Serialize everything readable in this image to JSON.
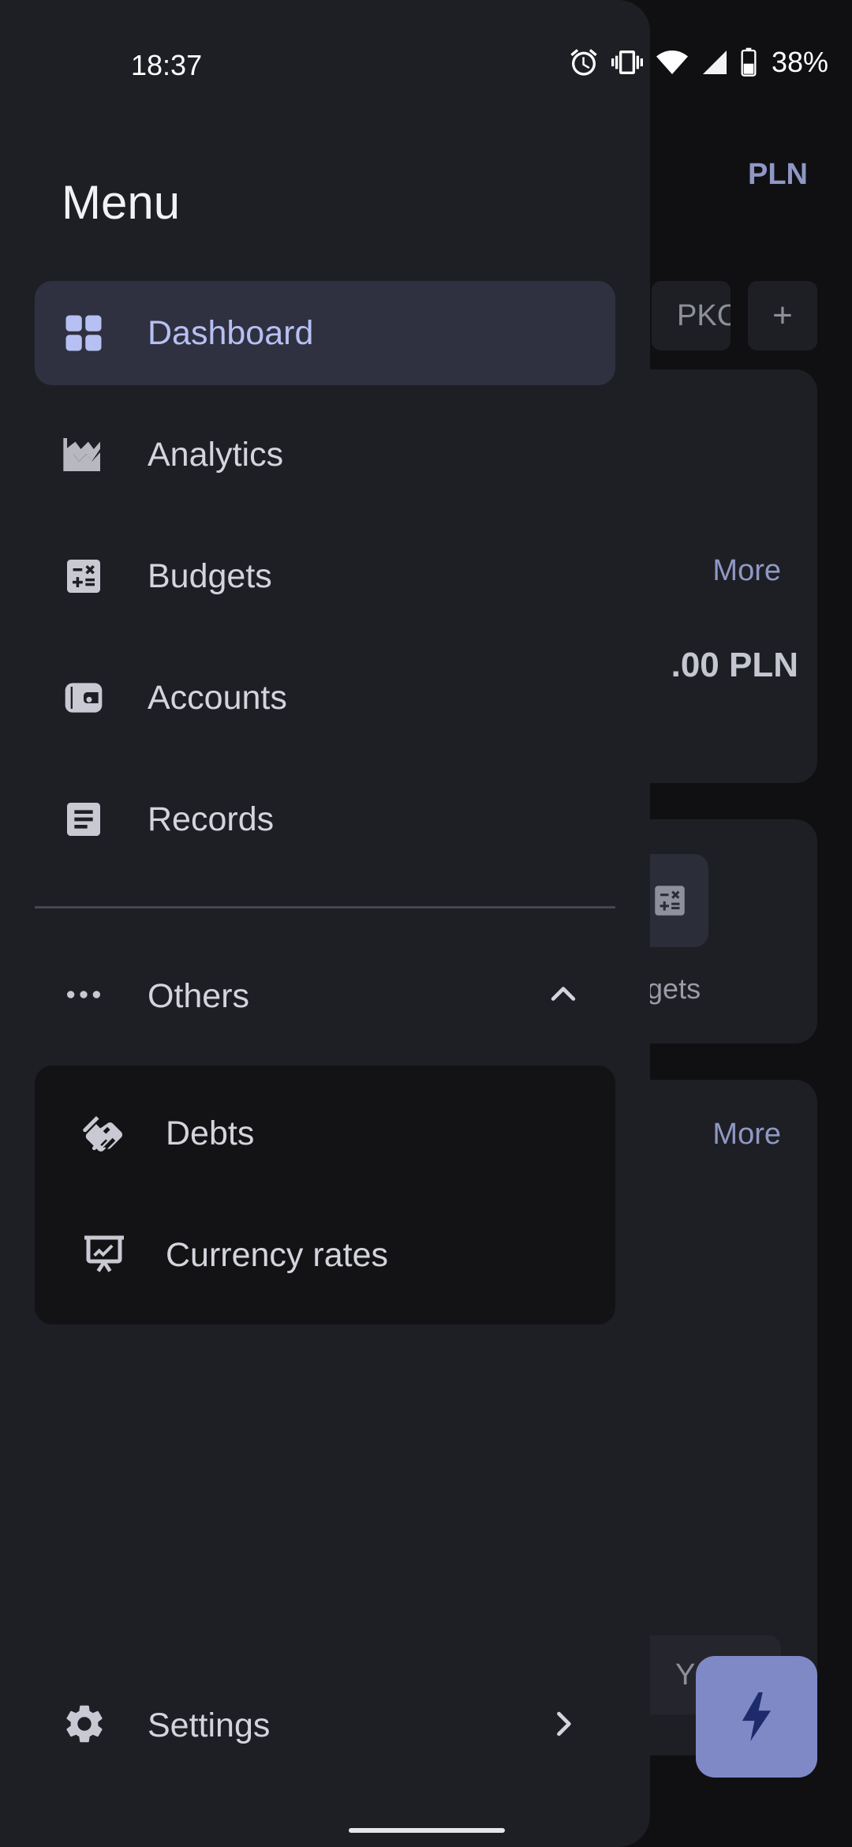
{
  "status_bar": {
    "time": "18:37",
    "battery": "38%"
  },
  "background": {
    "currency": "PLN",
    "account_chip": "PKC",
    "add_chip": "+",
    "more_label_1": "More",
    "amount_partial": ".00 PLN",
    "budgets_label_partial": "dgets",
    "more_label_2": "More",
    "toggle_partial": "Y"
  },
  "drawer": {
    "title": "Menu",
    "items": [
      {
        "label": "Dashboard",
        "icon": "dashboard-icon",
        "active": true
      },
      {
        "label": "Analytics",
        "icon": "chart-icon"
      },
      {
        "label": "Budgets",
        "icon": "calculator-icon"
      },
      {
        "label": "Accounts",
        "icon": "wallet-icon"
      },
      {
        "label": "Records",
        "icon": "document-icon"
      }
    ],
    "others": {
      "label": "Others",
      "icon": "more-horiz-icon",
      "expanded": true
    },
    "sub_items": [
      {
        "label": "Debts",
        "icon": "handshake-icon"
      },
      {
        "label": "Currency rates",
        "icon": "presentation-chart-icon"
      }
    ],
    "settings": {
      "label": "Settings",
      "icon": "gear-icon"
    }
  },
  "colors": {
    "drawer_bg": "#1e1f24",
    "active_bg": "#2f3140",
    "active_text": "#b7c0f2",
    "accent": "#7f89c6",
    "submenu_bg": "#131316"
  }
}
